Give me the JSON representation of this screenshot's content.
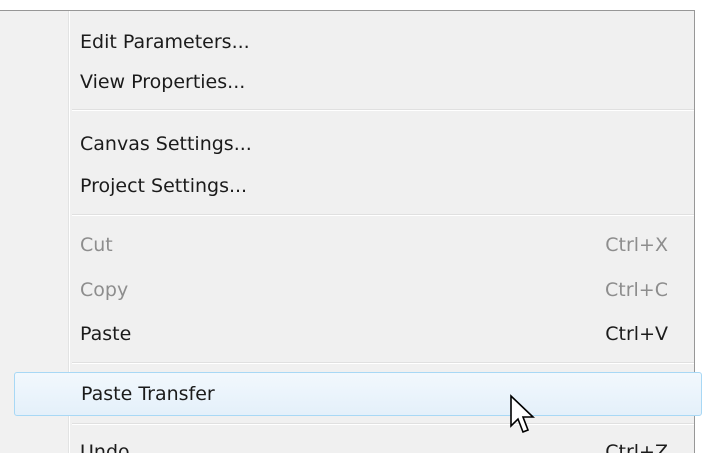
{
  "context_menu": {
    "groups": [
      {
        "items": [
          {
            "label": "Edit Parameters...",
            "shortcut": "",
            "state": "enabled"
          },
          {
            "label": "View Properties...",
            "shortcut": "",
            "state": "enabled"
          }
        ]
      },
      {
        "items": [
          {
            "label": "Canvas Settings...",
            "shortcut": "",
            "state": "enabled"
          },
          {
            "label": "Project Settings...",
            "shortcut": "",
            "state": "enabled"
          }
        ]
      },
      {
        "items": [
          {
            "label": "Cut",
            "shortcut": "Ctrl+X",
            "state": "disabled"
          },
          {
            "label": "Copy",
            "shortcut": "Ctrl+C",
            "state": "disabled"
          },
          {
            "label": "Paste",
            "shortcut": "Ctrl+V",
            "state": "enabled"
          }
        ]
      },
      {
        "items": [
          {
            "label": "Paste Transfer",
            "shortcut": "",
            "state": "highlighted"
          }
        ]
      },
      {
        "items": [
          {
            "label": "Undo",
            "shortcut": "Ctrl+Z",
            "state": "enabled"
          }
        ]
      }
    ]
  },
  "colors": {
    "menu_background": "#f0f0f0",
    "text": "#1b1b1b",
    "disabled_text": "#8d8d8d",
    "highlight_border": "#a8d8f5",
    "highlight_fill": "#e4f0fa"
  },
  "cursor": {
    "icon": "arrow-pointer-icon"
  }
}
